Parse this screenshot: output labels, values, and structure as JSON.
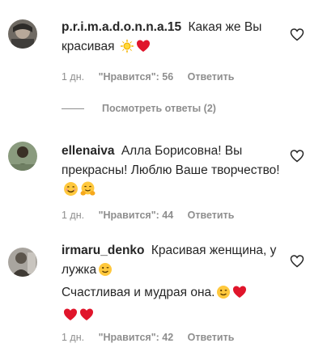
{
  "comments": [
    {
      "username": "p.r.i.m.a.d.o.n.n.a.15",
      "text_parts": [
        "Какая же Вы красивая"
      ],
      "time": "1 дн.",
      "likes": "\"Нравится\": 56",
      "reply": "Ответить",
      "emoji": [
        "sun-emoji",
        "red-heart-emoji"
      ]
    },
    {
      "username": "ellenaiva",
      "text_parts": [
        "Алла Борисовна! Вы прекрасны! Люблю Ваше творчество!"
      ],
      "time": "1 дн.",
      "likes": "\"Нравится\": 44",
      "reply": "Ответить",
      "emoji": [
        "smiling-face-emoji",
        "hugging-face-emoji"
      ]
    },
    {
      "username": "irmaru_denko",
      "text_parts": [
        "Красивая женщина, у лужка",
        "Счастливая и мудрая она."
      ],
      "time": "1 дн.",
      "likes": "\"Нравится\": 42",
      "reply": "Ответить",
      "emoji": [
        "winking-face-emoji",
        "winking-face-emoji",
        "red-heart-emoji",
        "red-heart-emoji",
        "red-heart-emoji"
      ]
    }
  ],
  "view_replies": "Посмотреть ответы (2)"
}
